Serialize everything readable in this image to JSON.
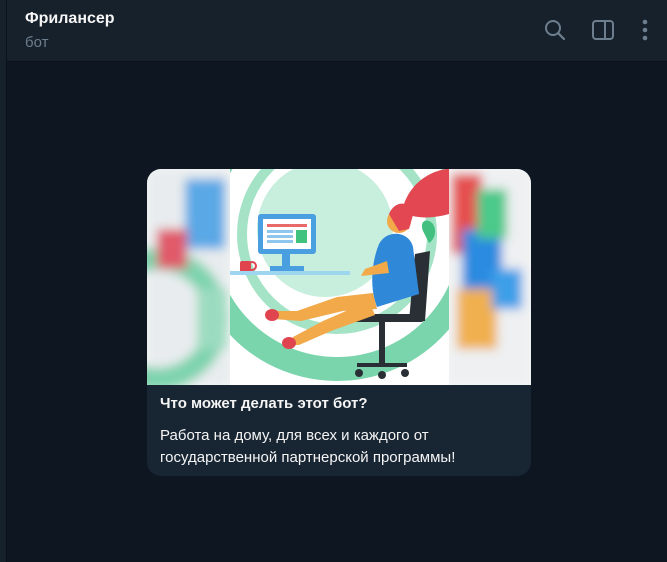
{
  "header": {
    "title": "Фрилансер",
    "subtitle": "бот",
    "icons": [
      "search-icon",
      "sidebar-toggle-icon",
      "more-vertical-icon"
    ]
  },
  "bot_info": {
    "heading": "Что может делать этот бот?",
    "description": "Работа на дому, для всех и каждого от государственной партнерской программы!",
    "image": "freelancer-illustration"
  },
  "colors": {
    "background": "#0e1621",
    "header": "#17212b",
    "card": "#182533",
    "text": "#f5f5f5",
    "muted": "#6d7f8f"
  }
}
